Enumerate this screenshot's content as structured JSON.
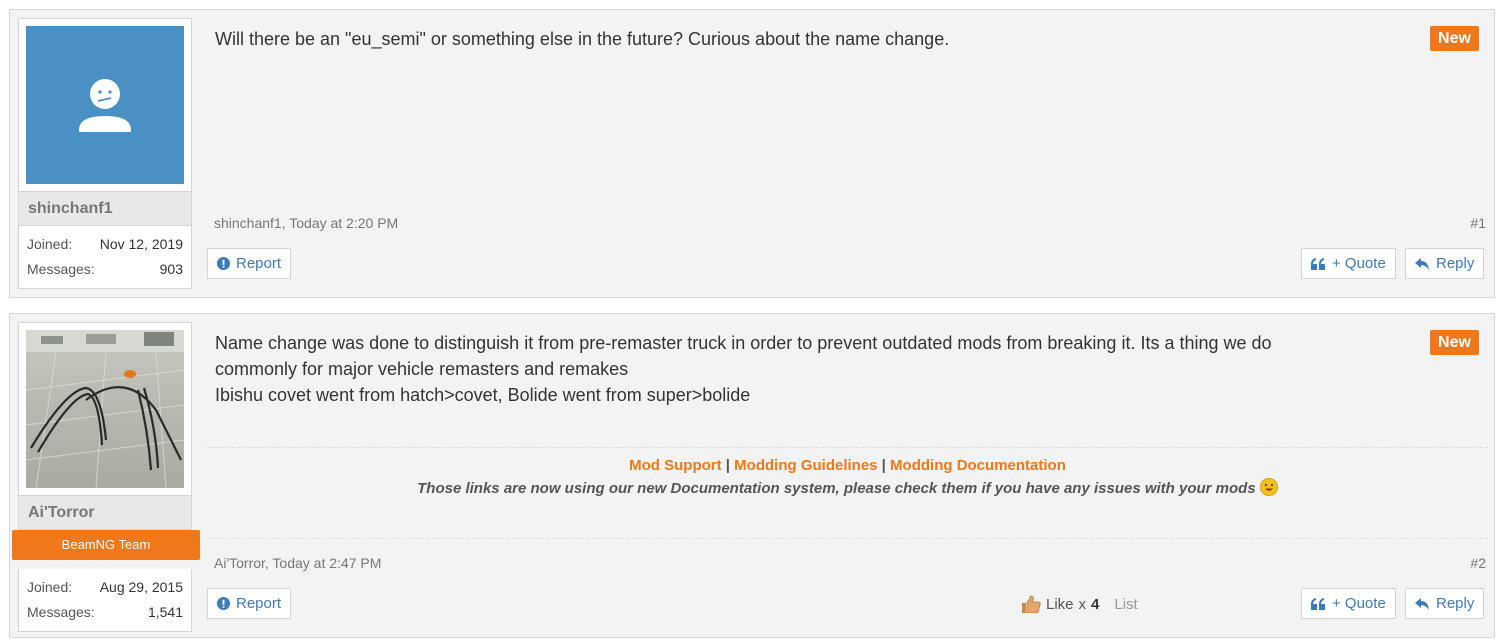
{
  "posts": [
    {
      "username": "shinchanf1",
      "joined_label": "Joined:",
      "joined": "Nov 12, 2019",
      "messages_label": "Messages:",
      "messages": "903",
      "badge": "New",
      "message": "Will there be an \"eu_semi\" or something else in the future? Curious about the name change.",
      "meta": "shinchanf1, Today at 2:20 PM",
      "number": "#1",
      "report_label": "Report",
      "quote_label": "+ Quote",
      "reply_label": "Reply"
    },
    {
      "username": "Ai'Torror",
      "user_title": "BeamNG Team",
      "joined_label": "Joined:",
      "joined": "Aug 29, 2015",
      "messages_label": "Messages:",
      "messages": "1,541",
      "badge": "New",
      "message_lines": [
        "Name change was done to distinguish it from pre-remaster truck in order to prevent outdated mods from breaking it. Its a thing we do",
        "commonly for major vehicle remasters and remakes",
        "Ibishu covet went from hatch>covet, Bolide went from super>bolide"
      ],
      "signature": {
        "links": [
          "Mod Support",
          "Modding Guidelines",
          "Modding Documentation"
        ],
        "separator": "|",
        "note": "Those links are now using our new Documentation system, please check them if you have any issues with your mods"
      },
      "meta": "Ai'Torror, Today at 2:47 PM",
      "number": "#2",
      "like_label": "Like",
      "like_x": "x",
      "like_count": "4",
      "list_label": "List",
      "report_label": "Report",
      "quote_label": "+ Quote",
      "reply_label": "Reply"
    }
  ],
  "colors": {
    "accent": "#f07818",
    "link": "#3d7ab8",
    "avatar_bg": "#4a90c4"
  }
}
